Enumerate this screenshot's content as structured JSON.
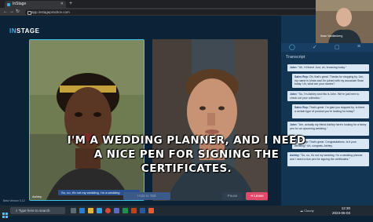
{
  "browser": {
    "tab_title": "InStage",
    "url": "app.instagepractice.com"
  },
  "app": {
    "logo_prefix": "IN",
    "logo_suffix": "STAGE"
  },
  "left_panel": {
    "name": "Ashley",
    "subtitle": "So, no, it's not my wedding. I'm a wedding"
  },
  "right_panel": {
    "name": "John"
  },
  "controls": {
    "left_button": "Hold to Talk",
    "pause_button": "Pause",
    "leave_button": "Leave"
  },
  "webcam": {
    "label": "Sean Vanillenberg"
  },
  "sidebar": {
    "transcript_title": "Transcript",
    "messages": [
      {
        "speaker": "John:",
        "text": "\"Uh, Hi there! Just, uh, browsing today.\""
      },
      {
        "speaker": "Sales Rep:",
        "text": "Oh, that's great. Thanks for stopping by. Um, my name is Imran and I'm joined with my associate Sean today. Uh, what are your names?"
      },
      {
        "speaker": "John:",
        "text": "\"So, I'm Ashley and this is John. We're just here to check out your collection.\""
      },
      {
        "speaker": "Sales Rep:",
        "text": "That's great. I'm glad you stopped by. Is there a certain type of product you're looking for today?"
      },
      {
        "speaker": "John:",
        "text": "\"Um, actually my friend Ashley here's looking for a fancy pen for an upcoming wedding.\""
      },
      {
        "speaker": "Sales Rep:",
        "text": "That's great. Congratulations. Is it your wedding? Uh, congrats, Ashley."
      },
      {
        "speaker": "Ashley:",
        "text": "\"So, no, it's not my wedding. I'm a wedding planner and I need a nice pen for signing the certificates.\""
      }
    ]
  },
  "caption": {
    "line1": "I'M A WEDDING PLANNER, AND I NEED",
    "line2": "A NICE PEN FOR SIGNING THE",
    "line3": "CERTIFICATES."
  },
  "taskbar": {
    "search_placeholder": "Type here to search",
    "weather": "Cloudy",
    "time": "12:30",
    "date": "2023-05-03"
  },
  "footer": {
    "beta": "Beta Version 0.12"
  }
}
